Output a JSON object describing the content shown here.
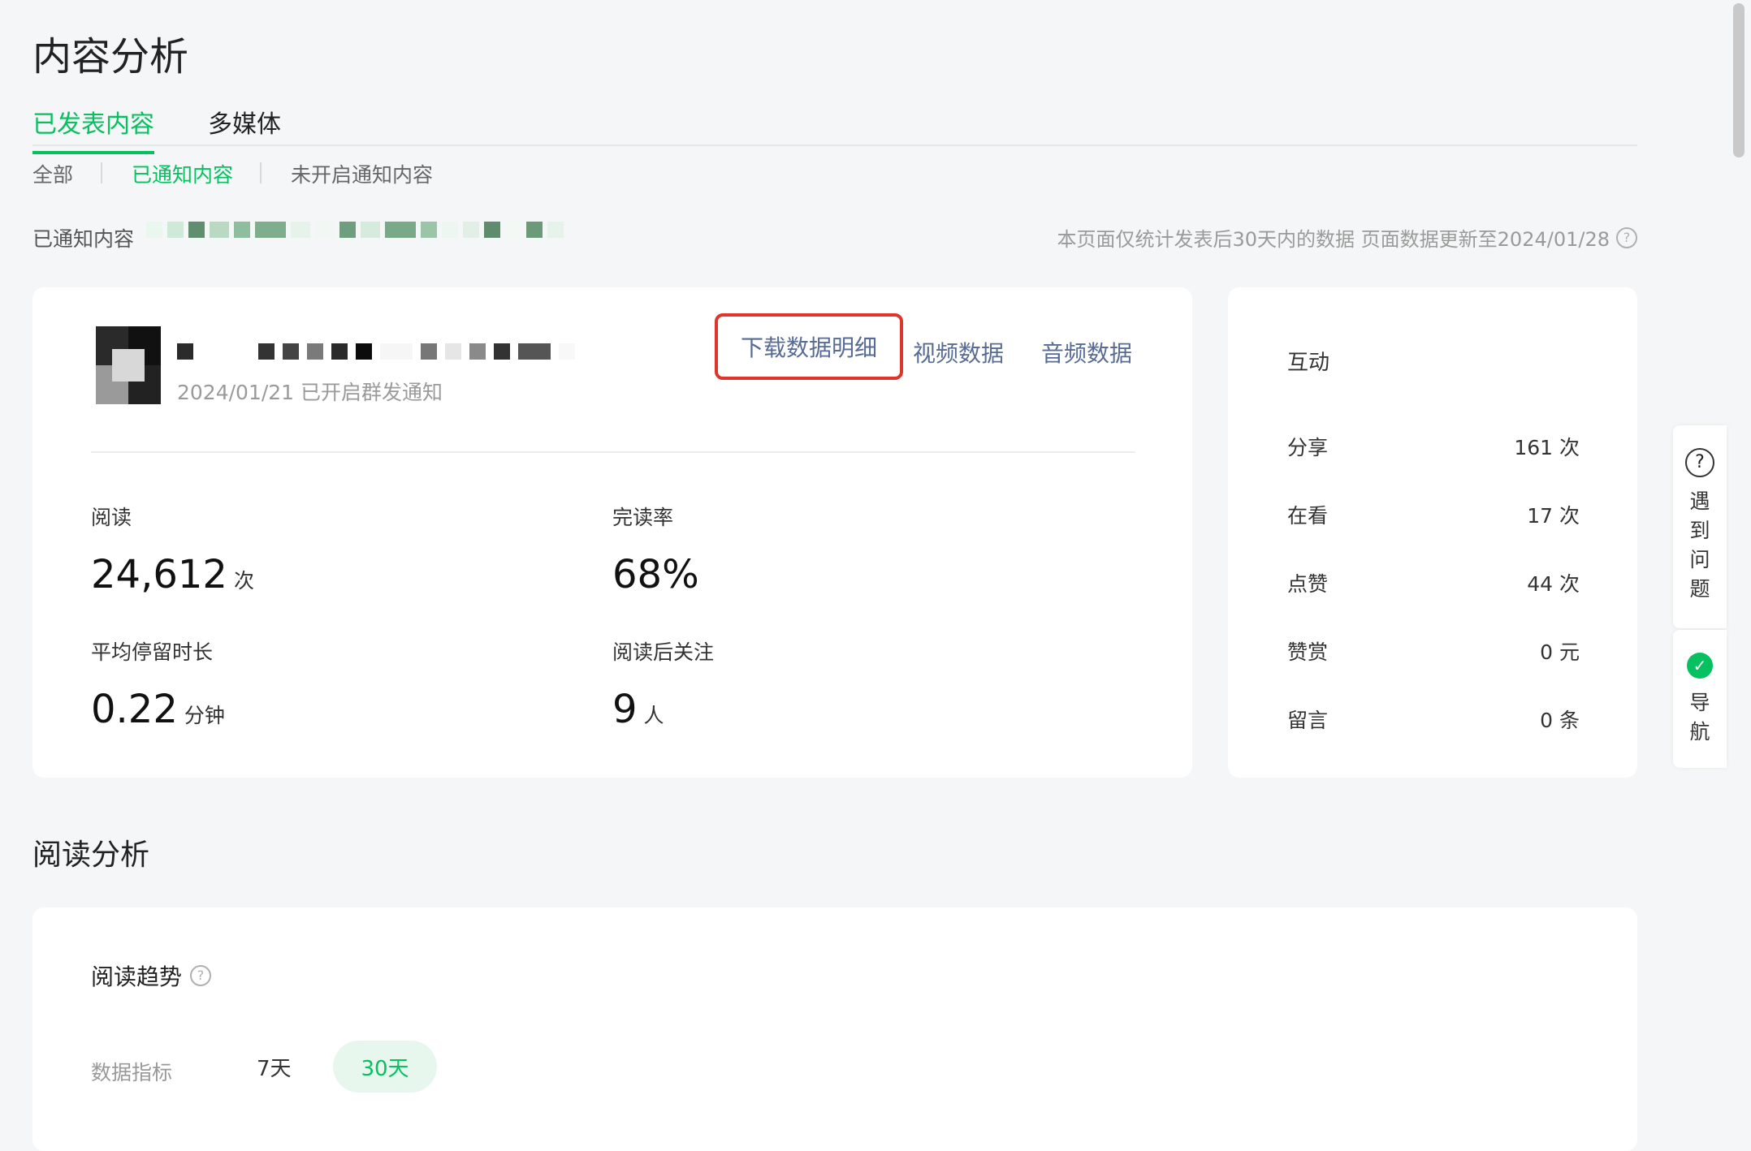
{
  "page": {
    "title": "内容分析"
  },
  "tabs": [
    {
      "label": "已发表内容"
    },
    {
      "label": "多媒体"
    }
  ],
  "subtabs": [
    {
      "label": "全部"
    },
    {
      "label": "已通知内容"
    },
    {
      "label": "未开启通知内容"
    }
  ],
  "notified": {
    "label": "已通知内容"
  },
  "stats_note": {
    "text": "本页面仅统计发表后30天内的数据 页面数据更新至2024/01/28"
  },
  "article": {
    "date_text": "2024/01/21 已开启群发通知",
    "download_label": "下载数据明细",
    "video_label": "视频数据",
    "audio_label": "音频数据"
  },
  "metrics": {
    "read": {
      "label": "阅读",
      "value": "24,612",
      "unit": "次"
    },
    "completion": {
      "label": "完读率",
      "value": "68%"
    },
    "avg_stay": {
      "label": "平均停留时长",
      "value": "0.22",
      "unit": "分钟"
    },
    "follow_after": {
      "label": "阅读后关注",
      "value": "9",
      "unit": "人"
    }
  },
  "interaction": {
    "title": "互动",
    "rows": [
      {
        "label": "分享",
        "value": "161 次"
      },
      {
        "label": "在看",
        "value": "17 次"
      },
      {
        "label": "点赞",
        "value": "44 次"
      },
      {
        "label": "赞赏",
        "value": "0 元"
      },
      {
        "label": "留言",
        "value": "0 条"
      }
    ]
  },
  "reading_analysis": {
    "title": "阅读分析",
    "trend_title": "阅读趋势",
    "filter_label": "数据指标",
    "range_7": "7天",
    "range_30": "30天"
  },
  "float": {
    "help_chars": [
      "遇",
      "到",
      "问",
      "题"
    ],
    "nav_chars": [
      "导",
      "航"
    ]
  },
  "icons": {
    "help": "question-circle-icon",
    "nav": "nav-logo-icon",
    "info": "question-circle-icon"
  },
  "colors": {
    "accent": "#07c160",
    "link": "#576b95",
    "highlight_border": "#e0352b"
  }
}
